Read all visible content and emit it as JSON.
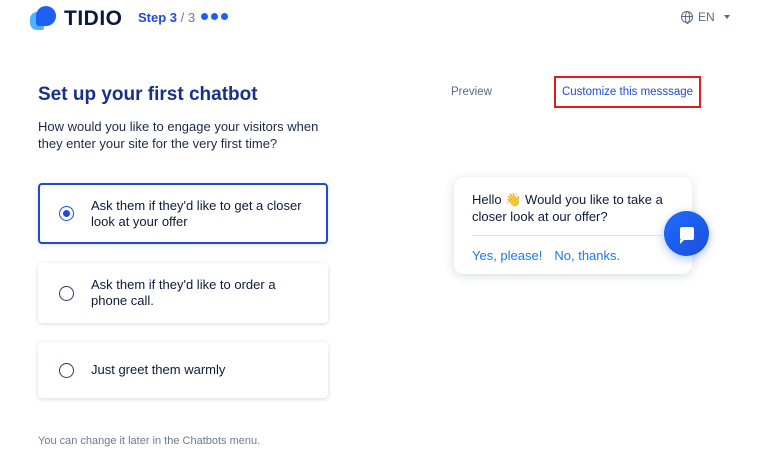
{
  "brand": {
    "name": "TIDIO",
    "logo_icon": "tidio-bubble-logo",
    "primary_color": "#1e4ad8",
    "highlight_color": "#e31b1b"
  },
  "stepper": {
    "current": "Step 3",
    "total": " / 3"
  },
  "language": {
    "icon": "globe-icon",
    "value": "EN"
  },
  "main": {
    "title": "Set up your first chatbot",
    "subtitle": "How would you like to engage your visitors when they enter your site for the very first time?",
    "options": [
      {
        "label": "Ask them if they'd like to get a closer look at your offer",
        "selected": true
      },
      {
        "label": "Ask them if they'd like to order a phone call.",
        "selected": false
      },
      {
        "label": "Just greet them warmly",
        "selected": false
      }
    ],
    "footer_note": "You can change it later in the Chatbots menu."
  },
  "preview": {
    "label": "Preview",
    "customize_link": "Customize this messsage",
    "message": "Hello 👋 Would you like to take a closer look at our offer?",
    "actions": [
      "Yes, please!",
      "No, thanks."
    ],
    "chat_icon": "chat-bubble-icon"
  }
}
